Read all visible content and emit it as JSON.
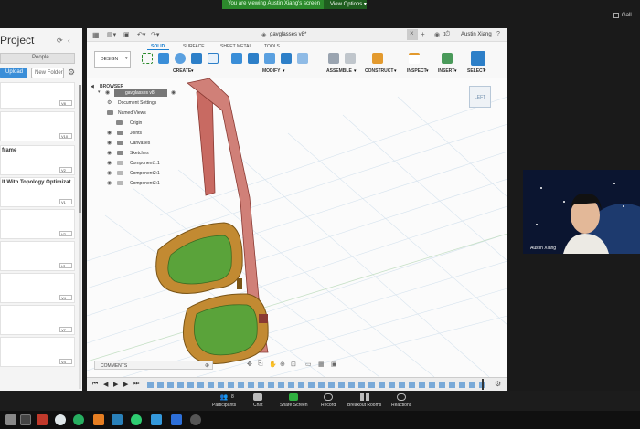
{
  "zoom": {
    "banner_message": "You are viewing Austin Xiang's screen",
    "view_options": "View Options",
    "top_right_user": "Gall",
    "video_name": "Austin Xiang",
    "controls": [
      {
        "label": "Participants",
        "count": "8"
      },
      {
        "label": "Chat"
      },
      {
        "label": "Share Screen"
      },
      {
        "label": "Record"
      },
      {
        "label": "Breakout Rooms"
      },
      {
        "label": "Reactions"
      }
    ]
  },
  "data_panel": {
    "title": "Project",
    "people_tab": "People",
    "upload": "Upload",
    "new_folder": "New Folder",
    "items": [
      {
        "name": "",
        "version": "V8"
      },
      {
        "name": "",
        "version": "V10"
      },
      {
        "name": "frame",
        "version": "V2"
      },
      {
        "name": "lf With Topology Optimizat...",
        "version": "V1"
      },
      {
        "name": "",
        "version": "V2"
      },
      {
        "name": "",
        "version": "V1"
      },
      {
        "name": "",
        "version": "V4"
      },
      {
        "name": "",
        "version": "V7"
      },
      {
        "name": "",
        "version": "V4"
      }
    ]
  },
  "fusion": {
    "doc_title": "gavglasses v8*",
    "user": "Austin Xiang",
    "notification_count": "1",
    "tabs": [
      "SOLID",
      "SURFACE",
      "SHEET METAL",
      "TOOLS"
    ],
    "active_tab": "SOLID",
    "workspace": "DESIGN",
    "groups": [
      "CREATE",
      "MODIFY",
      "ASSEMBLE",
      "CONSTRUCT",
      "INSPECT",
      "INSERT",
      "SELECT"
    ],
    "browser_header": "BROWSER",
    "browser_root": "gavglasses v8",
    "browser_items": [
      "Document Settings",
      "Named Views",
      "Origin",
      "Joints",
      "Canvases",
      "Sketches",
      "Component1:1",
      "Component2:1",
      "Component3:1"
    ],
    "comments_label": "COMMENTS",
    "viewcube_label": "LEFT"
  },
  "colors": {
    "banner_green": "#2c8a2c",
    "accent_blue": "#3a8ed8",
    "temple_red": "#c86a62",
    "frame_green": "#5aa33a",
    "frame_orange": "#c28a32"
  }
}
